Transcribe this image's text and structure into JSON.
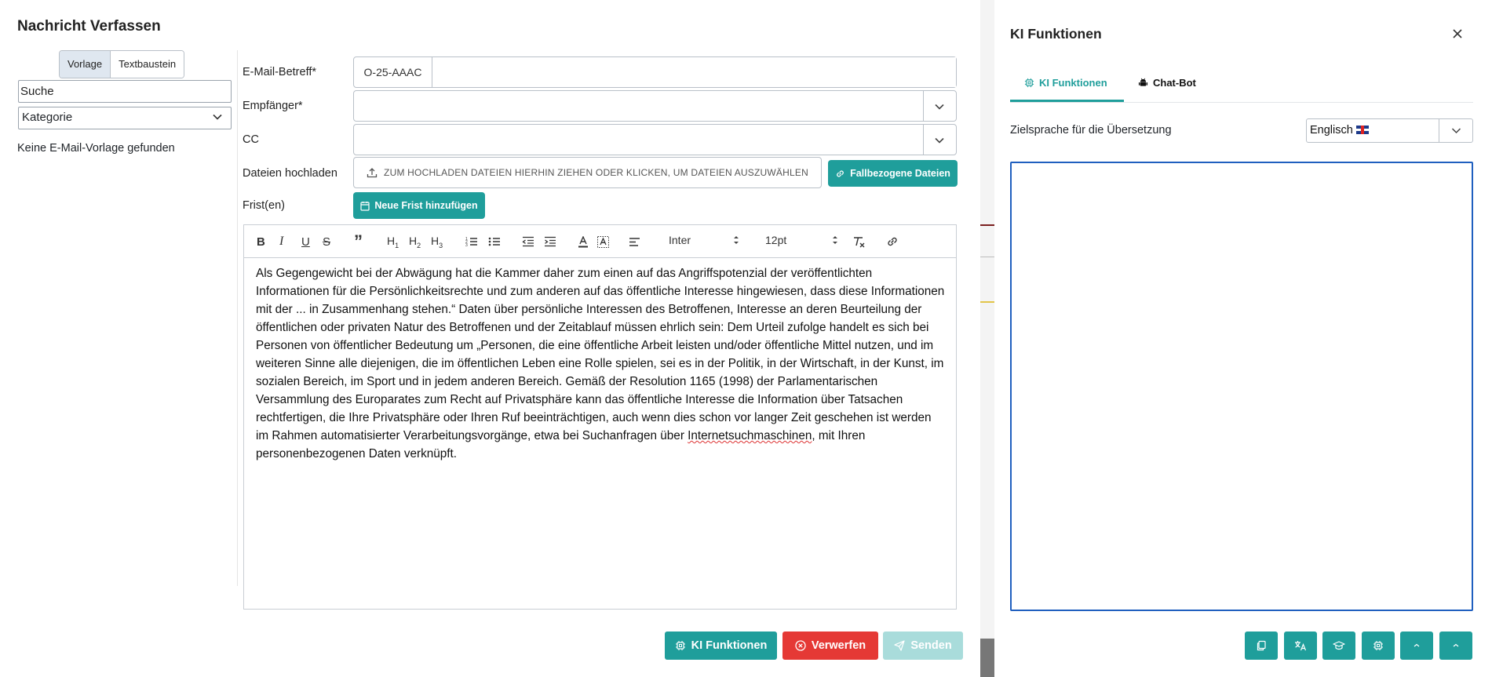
{
  "compose": {
    "title": "Nachricht Verfassen",
    "tabs": [
      "Vorlage",
      "Textbaustein"
    ],
    "search_placeholder": "Suche",
    "category_label": "Kategorie",
    "no_template": "Keine E-Mail-Vorlage gefunden",
    "fields": {
      "subject_label": "E-Mail-Betreff*",
      "subject_prefix": "O-25-AAAC",
      "subject_value": "",
      "recipient_label": "Empfänger*",
      "cc_label": "CC",
      "upload_label": "Dateien hochladen",
      "upload_text": "ZUM HOCHLADEN DATEIEN HIERHIN ZIEHEN ODER KLICKEN, UM DATEIEN AUSZUWÄHLEN",
      "case_files_button": "Fallbezogene Dateien",
      "deadline_label": "Frist(en)",
      "add_deadline_button": "Neue Frist hinzufügen"
    },
    "toolbar": {
      "font": "Inter",
      "size": "12pt"
    },
    "body_text_1": "Als Gegengewicht bei der Abwägung hat die Kammer daher zum einen auf das Angriffspotenzial der veröffentlichten Informationen für die Persönlichkeitsrechte und zum anderen auf das öffentliche Interesse hingewiesen, dass diese Informationen mit der ... in Zusammenhang stehen.“ Daten über persönliche Interessen des Betroffenen, Interesse an deren Beurteilung der öffentlichen oder privaten Natur des Betroffenen und der Zeitablauf müssen ehrlich sein: Dem Urteil zufolge handelt es sich bei Personen von öffentlicher Bedeutung um „Personen, die eine öffentliche Arbeit leisten und/oder öffentliche Mittel nutzen, und im weiteren Sinne alle diejenigen, die im öffentlichen Leben eine Rolle spielen, sei es in der Politik, in der Wirtschaft, in der Kunst, im sozialen Bereich, im Sport und in jedem anderen Bereich. Gemäß der Resolution 1165 (1998) der Parlamentarischen Versammlung des Europarates zum Recht auf Privatsphäre kann das öffentliche Interesse die Information über Tatsachen rechtfertigen, die Ihre Privatsphäre oder Ihren Ruf beeinträchtigen, auch wenn dies schon vor langer Zeit geschehen ist werden im Rahmen automatisierter Verarbeitungsvorgänge, etwa bei Suchanfragen über ",
    "body_text_link": "Internetsuchmaschinen",
    "body_text_2": ", mit Ihren personenbezogenen Daten verknüpft.",
    "footer": {
      "ki_button": "KI Funktionen",
      "discard_button": "Verwerfen",
      "send_button": "Senden"
    }
  },
  "ki_panel": {
    "title": "KI Funktionen",
    "tabs": [
      "KI Funktionen",
      "Chat-Bot"
    ],
    "target_language_label": "Zielsprache für die Übersetzung",
    "target_language_value": "Englisch",
    "target_language_icon": "uk-flag-icon",
    "output_text": "",
    "actions": [
      "copy-icon",
      "translate-icon",
      "graduation-cap-icon",
      "chip-icon",
      "chevron-up-icon",
      "chevron-up-icon"
    ]
  },
  "colors": {
    "accent": "#1f9e9b",
    "danger": "#e53935",
    "disabled_accent": "#a9dcdb",
    "focus_border": "#1f5fbf"
  }
}
